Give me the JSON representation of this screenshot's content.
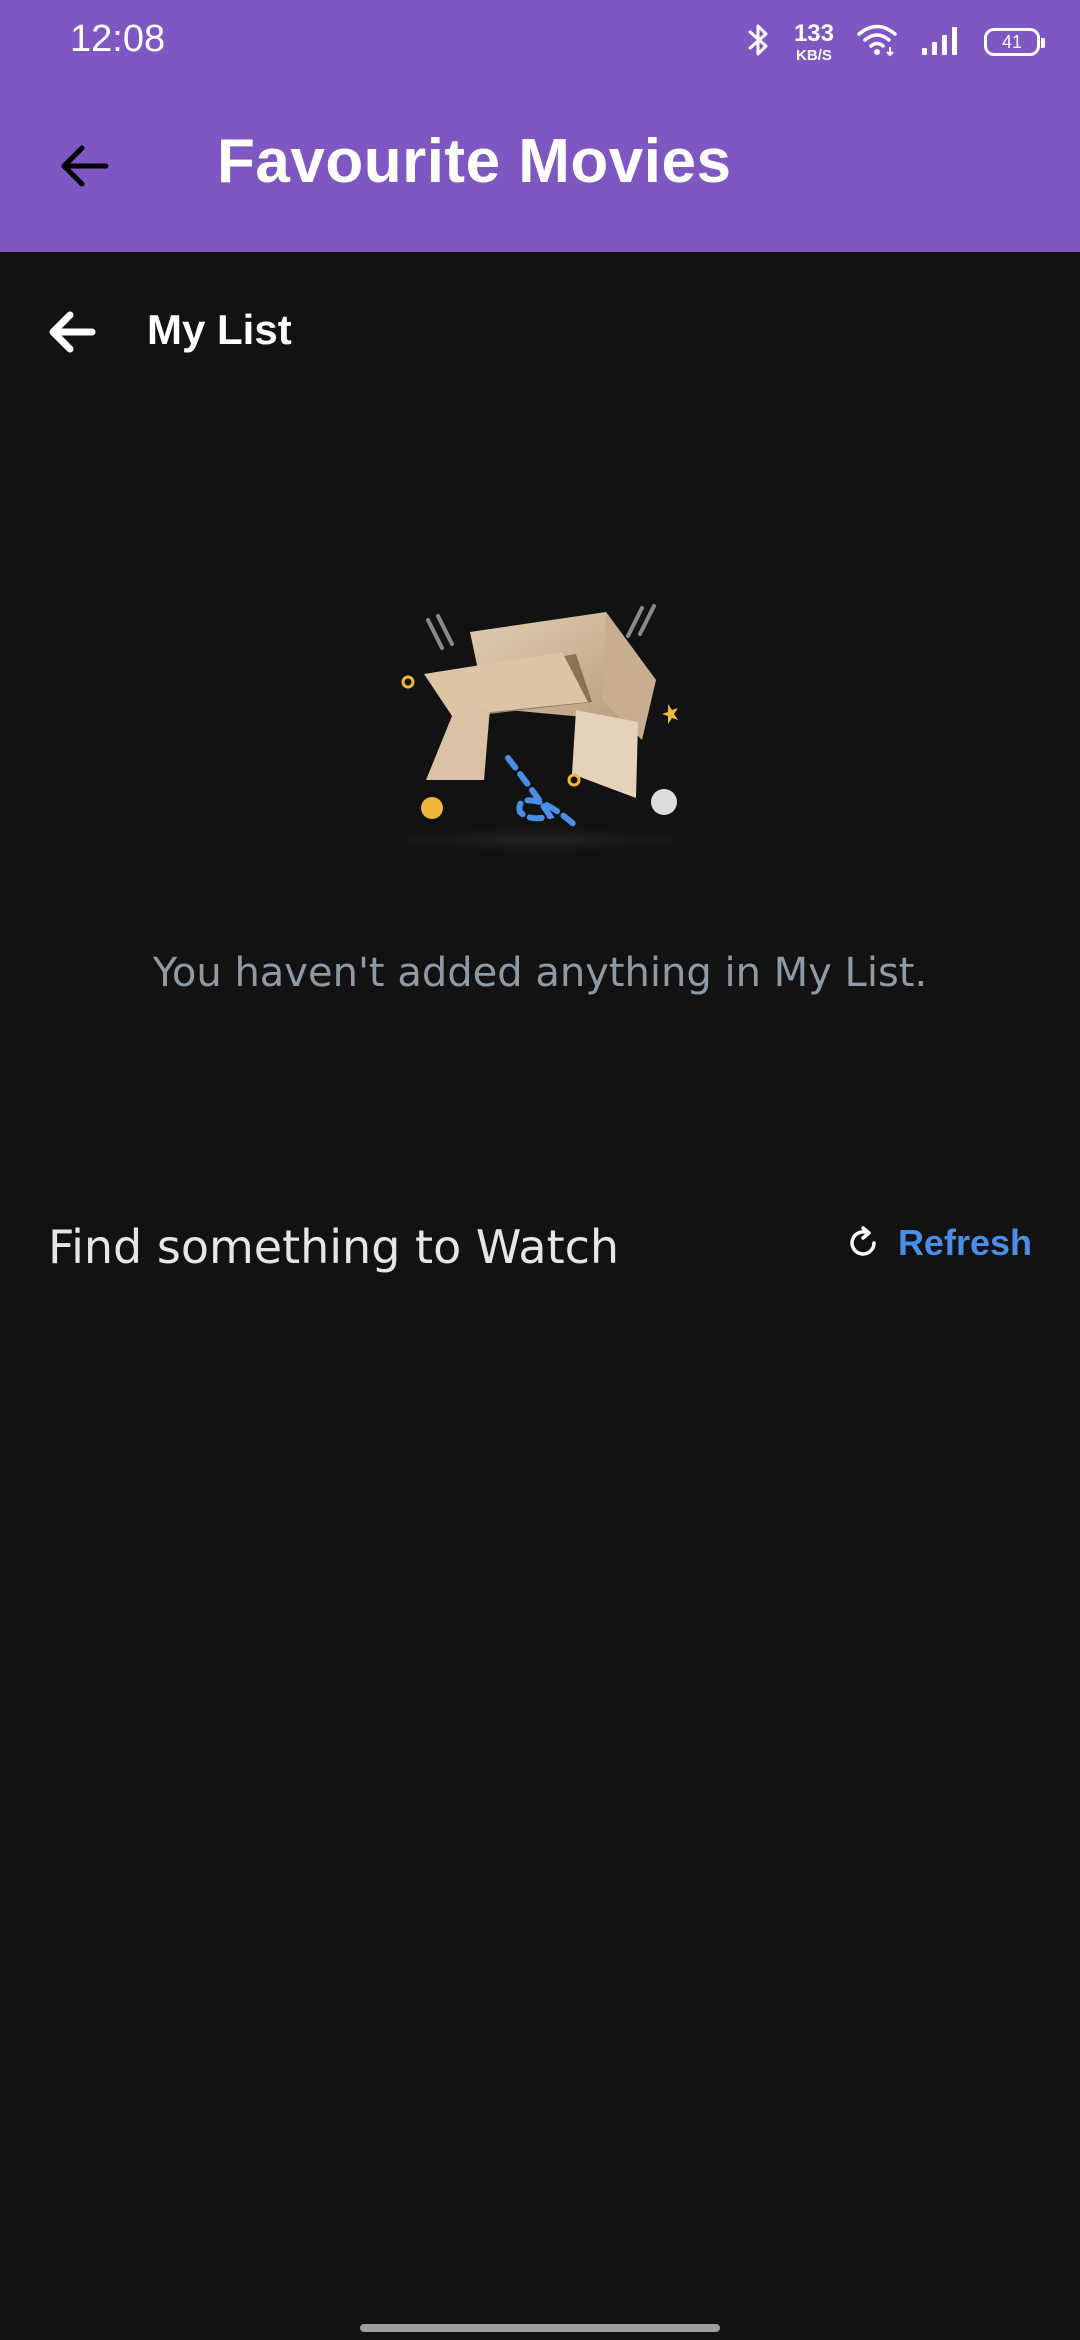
{
  "status_bar": {
    "time": "12:08",
    "speed_value": "133",
    "speed_unit": "KB/S",
    "battery": "41",
    "icons": [
      "bluetooth-icon",
      "wifi-icon",
      "signal-icon",
      "battery-icon"
    ]
  },
  "app_bar": {
    "title": "Favourite Movies",
    "back_icon": "arrow-left-icon"
  },
  "list_header": {
    "title": "My List",
    "back_icon": "arrow-left-icon"
  },
  "empty_state": {
    "illustration": "empty-box-illustration",
    "message": "You haven't added anything in My List."
  },
  "find_section": {
    "title": "Find something to Watch",
    "refresh_label": "Refresh",
    "refresh_icon": "refresh-icon"
  },
  "colors": {
    "app_bar": "#7e57c2",
    "background": "#121212",
    "accent": "#4a8ee8",
    "muted_text": "#8e9aa5"
  }
}
